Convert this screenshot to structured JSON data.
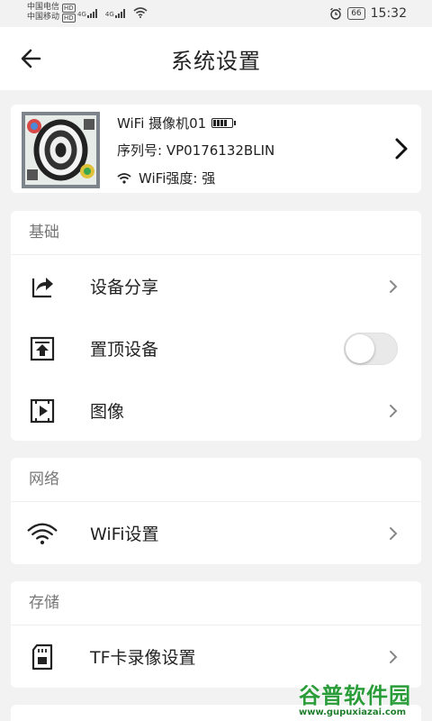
{
  "statusbar": {
    "carrier1": "中国电信",
    "carrier2": "中国移动",
    "hd": "HD",
    "net1": "4G",
    "net2": "4G",
    "battery": "66",
    "time": "15:32"
  },
  "header": {
    "title": "系统设置"
  },
  "device": {
    "name": "WiFi 摄像机01",
    "serial": "序列号: VP0176132BLIN",
    "wifi": "WiFi强度: 强"
  },
  "sections": {
    "basic": {
      "title": "基础",
      "items": [
        {
          "label": "设备分享",
          "icon": "share-icon"
        },
        {
          "label": "置顶设备",
          "icon": "pin-top-icon",
          "toggle": false
        },
        {
          "label": "图像",
          "icon": "image-play-icon"
        }
      ]
    },
    "network": {
      "title": "网络",
      "items": [
        {
          "label": "WiFi设置",
          "icon": "wifi-icon"
        }
      ]
    },
    "storage": {
      "title": "存储",
      "items": [
        {
          "label": "TF卡录像设置",
          "icon": "sd-card-icon"
        }
      ]
    }
  },
  "watermark": {
    "main": "谷普软件园",
    "sub": "www.gupuxiazai.com"
  }
}
